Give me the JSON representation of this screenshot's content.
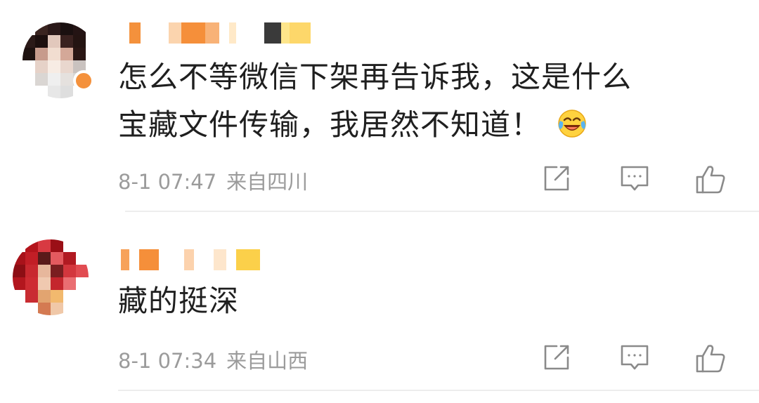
{
  "comments": [
    {
      "text_lines": [
        "怎么不等微信下架再告诉我，这是什么",
        "宝藏文件传输，我居然不知道！"
      ],
      "emoji": "laugh-cry-icon",
      "time": "8-1 07:47",
      "location": "来自四川"
    },
    {
      "text_lines": [
        "藏的挺深"
      ],
      "time": "8-1 07:34",
      "location": "来自山西"
    }
  ],
  "actions": {
    "share_icon": "share-icon",
    "reply_icon": "reply-icon",
    "like_icon": "like-icon"
  },
  "colors": {
    "meta_text": "#9b9b9b",
    "icon": "#8a8a8a",
    "divider": "#ededed",
    "mosaic_orange": "#f4913c"
  }
}
